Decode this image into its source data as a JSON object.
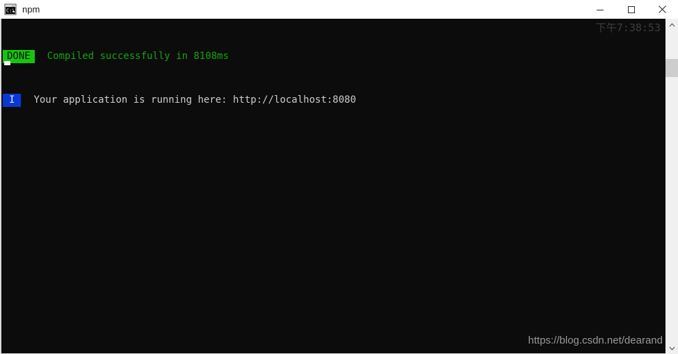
{
  "window": {
    "title": "npm",
    "icon": "cmd-console-icon",
    "controls": {
      "minimize_label": "Minimize",
      "maximize_label": "Maximize",
      "close_label": "Close"
    }
  },
  "console": {
    "background_color": "#0c0c0c",
    "lines": [
      {
        "badge": "DONE",
        "badge_bg": "#16c60c",
        "badge_fg": "#0c0c0c",
        "message": "Compiled successfully in 8108ms",
        "message_color": "#13a10e"
      },
      {
        "badge": "I",
        "badge_bg": "#0b37d6",
        "badge_fg": "#e8e8e8",
        "message": "Your application is running here: http://localhost:8080",
        "message_color": "#cccccc"
      }
    ],
    "clock": "下午7:38:53",
    "watermark": "https://blog.csdn.net/dearand",
    "cursor_visible": true
  },
  "scrollbar": {
    "up_arrow": "chevron-up-icon",
    "down_arrow": "chevron-down-icon",
    "thumb_color": "#cdcdcd",
    "track_color": "#f0f0f0"
  }
}
